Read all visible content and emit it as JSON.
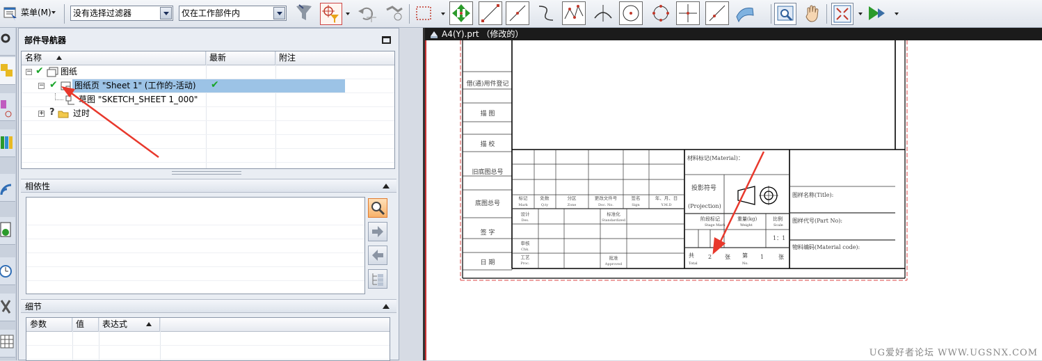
{
  "toolbar": {
    "menu_label": "菜单(M)",
    "filter_combo": "没有选择过滤器",
    "scope_combo": "仅在工作部件内"
  },
  "navigator": {
    "title": "部件导航器",
    "columns": [
      "名称",
      "最新",
      "附注"
    ],
    "tree": {
      "drawing_label": "图纸",
      "sheet_label": "图纸页 \"Sheet 1\" (工作的-活动)",
      "sketch_label": "草图 \"SKETCH_SHEET 1_000\"",
      "obsolete_label": "过时"
    }
  },
  "dependencies": {
    "title": "相依性"
  },
  "details": {
    "title": "细节",
    "columns": [
      "参数",
      "值",
      "表达式"
    ]
  },
  "drawing": {
    "window_title": "A4(Y).prt  （修改的）",
    "left_column": [
      "借(通)用件登记",
      "描 图",
      "描 校",
      "旧底图总号",
      "底图总号",
      "签 字",
      "日 期"
    ],
    "rev_headers": [
      "标记",
      "处数",
      "分区",
      "更改文件号",
      "签名",
      "年、月、日"
    ],
    "rev_headers_en": [
      "Mark",
      "Q.ty",
      "Zone",
      "Doc. No.",
      "Sign",
      "Y.M.D"
    ],
    "sign_rows": [
      "设计",
      "审核",
      "工艺"
    ],
    "sign_rows_en": [
      "Des.",
      "Chk.",
      "Proc."
    ],
    "standardize": "标准化",
    "standardize_en": "Standardized",
    "approve": "批准",
    "approve_en": "Approved",
    "material_label": "材料标记(Material)：",
    "projection_label": "投影符号",
    "projection_en": "(Projection)",
    "stage_label": "阶段标记",
    "stage_en": "Stage Mark",
    "weight_label": "重量(kg)",
    "weight_en": "Weight",
    "scale_label": "比例",
    "scale_en": "Scale",
    "scale_value": "1：1",
    "total_label": "共",
    "total_en": "Total",
    "sheet_count": "2",
    "zhang1": "张",
    "no_label": "第",
    "no_en": "No.",
    "sheet_no": "1",
    "zhang2": "张",
    "title_name": "图样名称(Title):",
    "part_no": "图样代号(Part No):",
    "material_code": "物料编码(Material code):"
  },
  "watermark": "UG爱好者论坛 WWW.UGSNX.COM",
  "colors": {
    "selection": "#9cc3e6",
    "check": "#1aa52a",
    "annotation_arrow": "#e8382c",
    "window_title_bg": "#1b1b1b"
  }
}
